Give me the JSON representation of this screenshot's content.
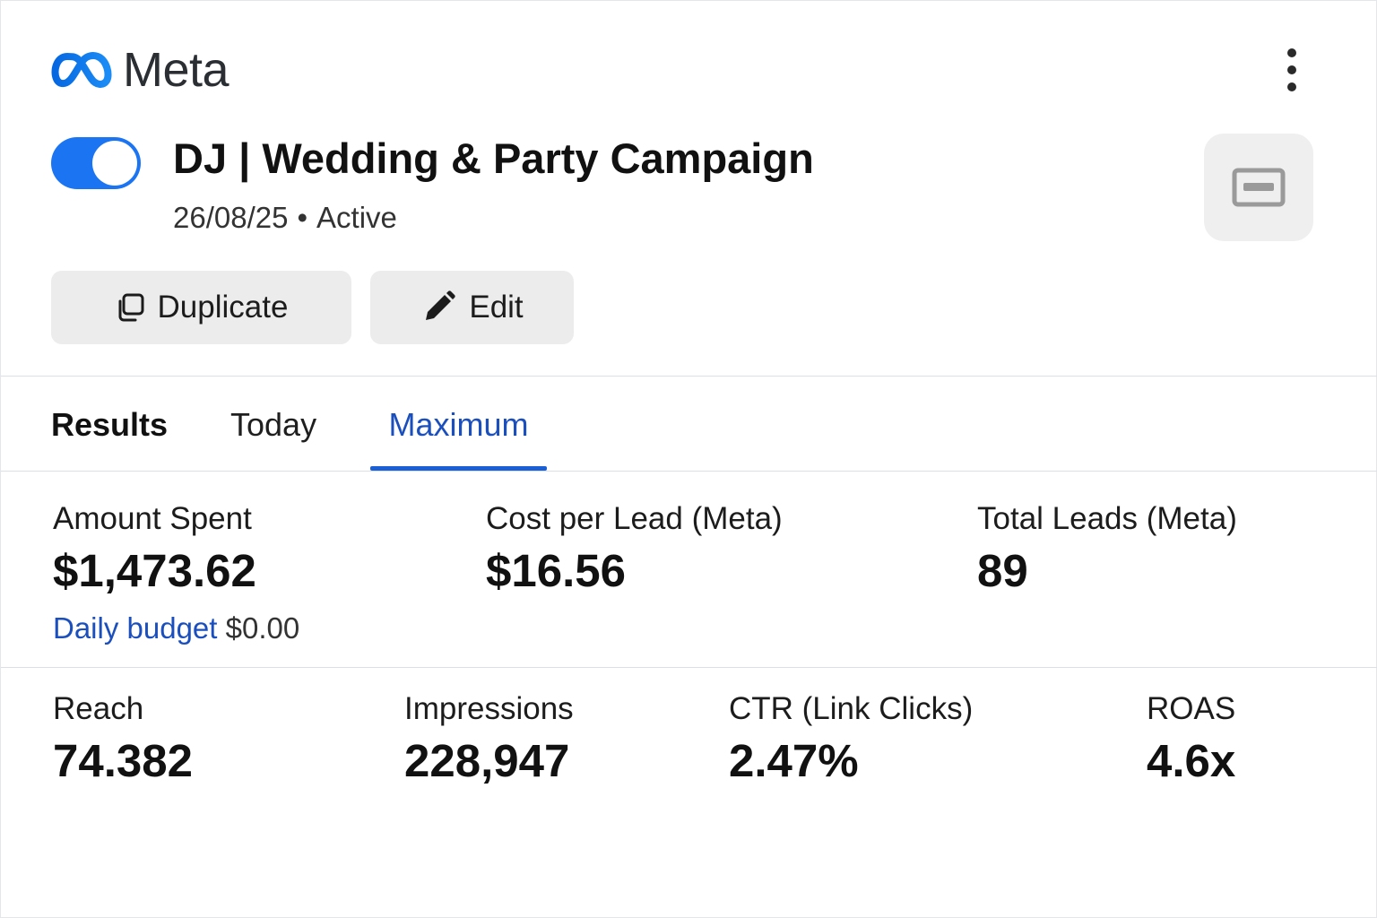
{
  "header": {
    "logo_text": "Meta",
    "brand_color": "#1b74f2",
    "more_icon": "more-vertical-icon"
  },
  "campaign": {
    "title": "DJ | Wedding & Party Campaign",
    "date": "26/08/25",
    "separator": "•",
    "status": "Active",
    "toggle_on": true,
    "preview_icon": "ad-preview-icon"
  },
  "actions": {
    "duplicate_label": "Duplicate",
    "duplicate_icon": "copy-icon",
    "edit_label": "Edit",
    "edit_icon": "pencil-icon"
  },
  "tabs": [
    {
      "label": "Results",
      "active": false
    },
    {
      "label": "Today",
      "active": false
    },
    {
      "label": "Maximum",
      "active": true
    }
  ],
  "metrics_primary": [
    {
      "label": "Amount Spent",
      "value": "$1,473.62"
    },
    {
      "label": "Cost per Lead (Meta)",
      "value": "$16.56"
    },
    {
      "label": "Total Leads (Meta)",
      "value": "89"
    }
  ],
  "budget": {
    "link_label": "Daily budget",
    "value": "$0.00"
  },
  "metrics_secondary": [
    {
      "label": "Reach",
      "value": "74.382"
    },
    {
      "label": "Impressions",
      "value": "228,947"
    },
    {
      "label": "CTR (Link Clicks)",
      "value": "2.47%"
    },
    {
      "label": "ROAS",
      "value": "4.6x"
    }
  ],
  "colors": {
    "accent": "#1b74f2",
    "tab_active": "#1a4fbd",
    "button_bg": "#ececec"
  }
}
